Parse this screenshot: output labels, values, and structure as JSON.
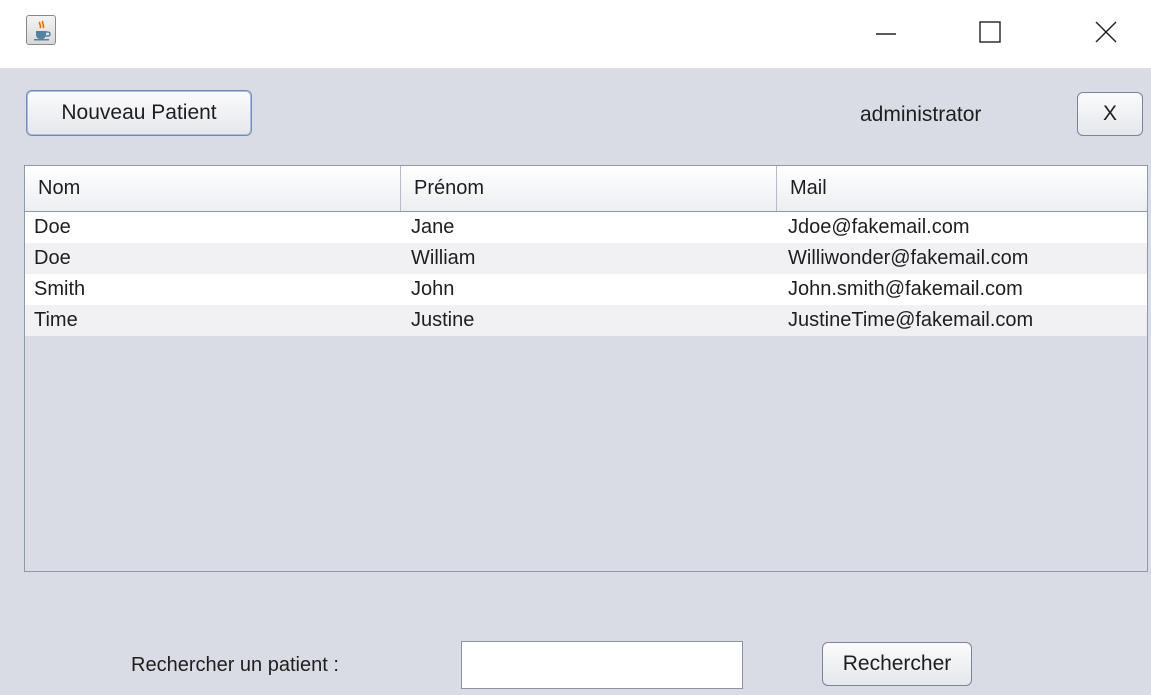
{
  "window": {
    "icons": {
      "app": "java-cup-icon",
      "minimize": "minimize-icon",
      "maximize": "maximize-icon",
      "close": "close-icon"
    }
  },
  "toolbar": {
    "new_patient_label": "Nouveau Patient",
    "user": "administrator",
    "logout_label": "X"
  },
  "table": {
    "columns": [
      "Nom",
      "Prénom",
      "Mail"
    ],
    "rows": [
      [
        "Doe",
        "Jane",
        "Jdoe@fakemail.com"
      ],
      [
        "Doe",
        "William",
        "Williwonder@fakemail.com"
      ],
      [
        "Smith",
        "John",
        "John.smith@fakemail.com"
      ],
      [
        "Time",
        "Justine",
        "JustineTime@fakemail.com"
      ]
    ]
  },
  "search": {
    "label": "Rechercher un patient :",
    "value": "",
    "button_label": "Rechercher"
  },
  "colors": {
    "panel": "#dadce5",
    "row_alt": "#f1f1f3",
    "button_focus_border": "#6f8cb6"
  }
}
